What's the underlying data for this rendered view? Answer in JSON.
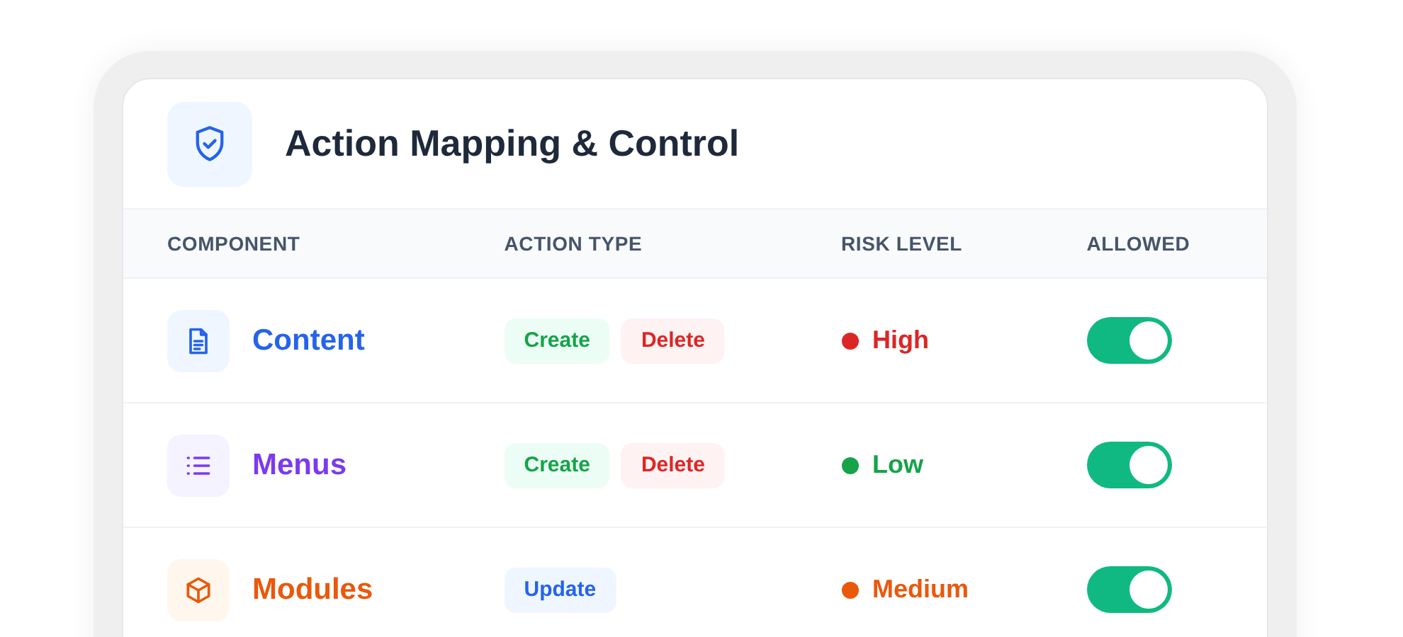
{
  "card": {
    "title": "Action Mapping & Control"
  },
  "table": {
    "columns": [
      "COMPONENT",
      "ACTION TYPE",
      "RISK LEVEL",
      "ALLOWED"
    ],
    "rows": [
      {
        "component": {
          "name": "Content",
          "kind": "document",
          "color": "#2563eb"
        },
        "actions": [
          {
            "label": "Create",
            "kind": "create"
          },
          {
            "label": "Delete",
            "kind": "delete"
          }
        ],
        "risk": {
          "label": "High",
          "color": "#dc2626"
        },
        "allowed": {
          "on": true
        }
      },
      {
        "component": {
          "name": "Menus",
          "kind": "list",
          "color": "#7c3aed"
        },
        "actions": [
          {
            "label": "Create",
            "kind": "create"
          },
          {
            "label": "Delete",
            "kind": "delete"
          }
        ],
        "risk": {
          "label": "Low",
          "color": "#16a34a"
        },
        "allowed": {
          "on": true
        }
      },
      {
        "component": {
          "name": "Modules",
          "kind": "box",
          "color": "#ea580c"
        },
        "actions": [
          {
            "label": "Update",
            "kind": "update"
          }
        ],
        "risk": {
          "label": "Medium",
          "color": "#ea580c"
        },
        "allowed": {
          "on": true
        }
      }
    ]
  }
}
